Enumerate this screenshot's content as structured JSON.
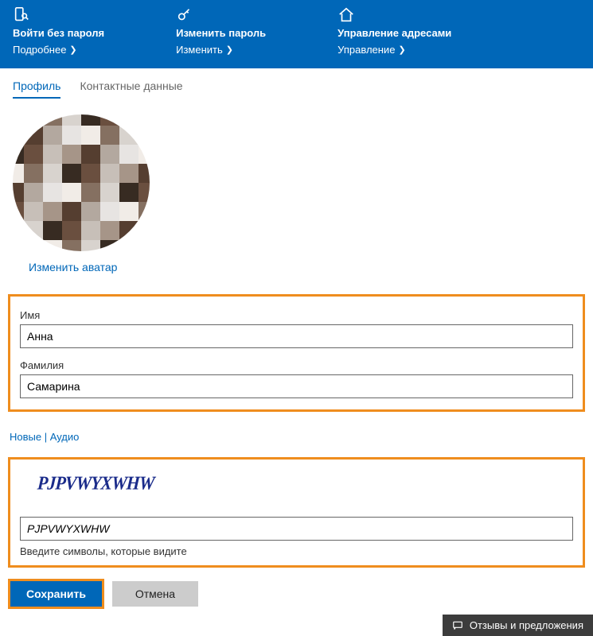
{
  "header": {
    "cards": [
      {
        "title": "Войти без пароля",
        "link": "Подробнее"
      },
      {
        "title": "Изменить пароль",
        "link": "Изменить"
      },
      {
        "title": "Управление адресами",
        "link": "Управление"
      }
    ]
  },
  "tabs": {
    "profile": "Профиль",
    "contact": "Контактные данные"
  },
  "avatar": {
    "change": "Изменить аватар"
  },
  "form": {
    "first_label": "Имя",
    "first_value": "Анна",
    "last_label": "Фамилия",
    "last_value": "Самарина"
  },
  "captcha": {
    "new": "Новые",
    "sep": " | ",
    "audio": "Аудио",
    "image_text": "PJPVWYXWHW",
    "input_value": "PJPVWYXWHW",
    "hint": "Введите символы, которые видите"
  },
  "buttons": {
    "save": "Сохранить",
    "cancel": "Отмена"
  },
  "feedback": "Отзывы и предложения"
}
